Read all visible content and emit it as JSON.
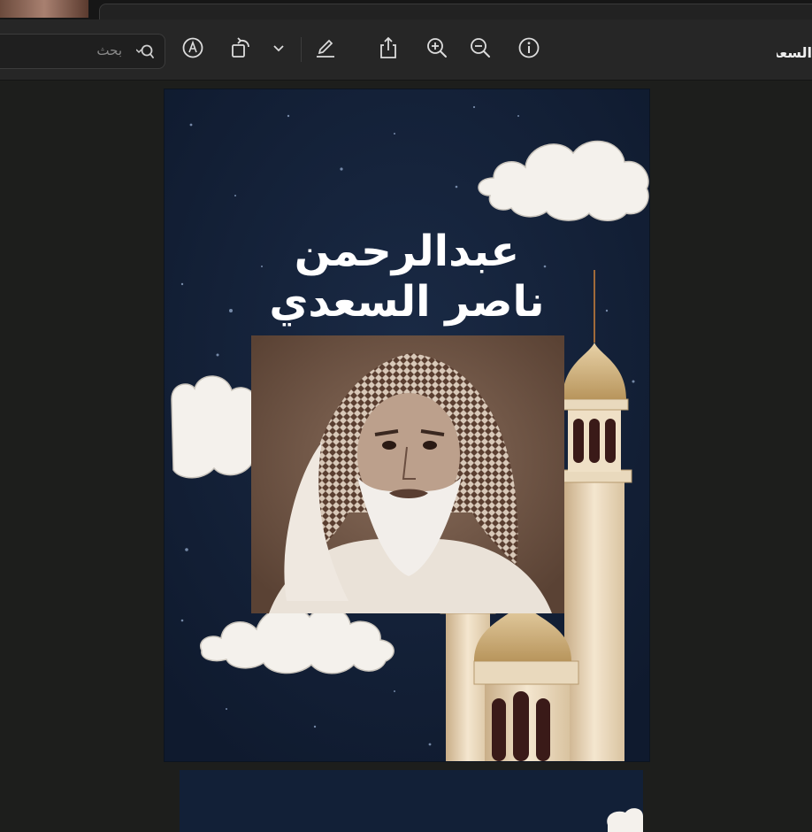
{
  "window": {
    "title": "السعدي"
  },
  "toolbar": {
    "search_placeholder": "بحث",
    "buttons": [
      {
        "name": "markup-icon"
      },
      {
        "name": "rotate-icon"
      },
      {
        "name": "chevron-down-icon"
      },
      {
        "name": "pencil-icon"
      },
      {
        "name": "share-icon"
      },
      {
        "name": "zoom-in-icon"
      },
      {
        "name": "zoom-out-icon"
      },
      {
        "name": "info-icon"
      }
    ]
  },
  "document": {
    "heading_line1": "عبدالرحمن",
    "heading_line2": "ناصر السعدي",
    "background_color": "#122037",
    "portrait_tone": "sepia"
  }
}
